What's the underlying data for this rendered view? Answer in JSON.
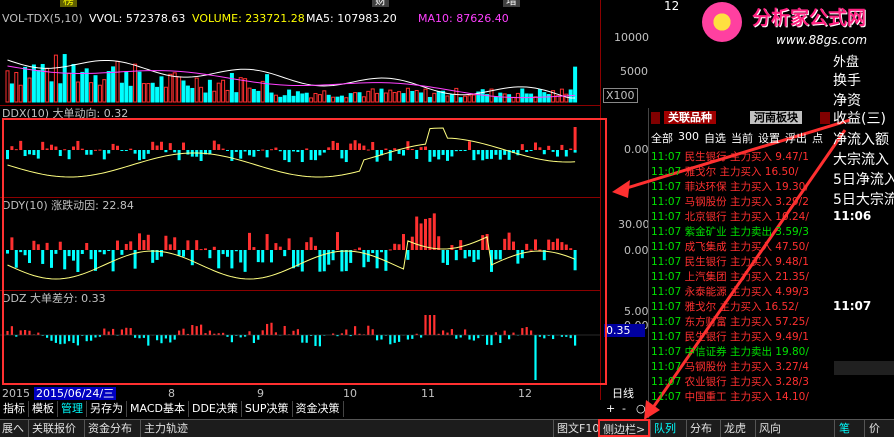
{
  "top_strip": {
    "c1": "榜",
    "c2": "财",
    "c3": "增",
    "price_top": "12"
  },
  "vol_header": {
    "name": "VOL-TDX(5,10)",
    "vvol": "VVOL: 572378.63",
    "volume": "VOLUME: 233721.28",
    "ma5": "MA5: 107983.20",
    "ma10": "MA10: 87626.40"
  },
  "vol_axis": {
    "t1": "10000",
    "t2": "5000",
    "unit": "X100"
  },
  "ddx": {
    "title": "DDX(10) 大单动向: 0.32",
    "zero": "0.00"
  },
  "ddy": {
    "title": "DDY(10) 涨跌动因: 22.84",
    "top": "30.00",
    "zero": "0.00"
  },
  "ddz": {
    "title": "DDZ 大单差分: 0.33",
    "top": "5.00",
    "zero": "0.00",
    "cur": "0.35"
  },
  "dates": {
    "year": "2015",
    "sel": "2015/06/24/三",
    "d8": "8",
    "d9": "9",
    "d10": "10",
    "d11": "11",
    "d12": "12",
    "period": "日线"
  },
  "toolbar": [
    "指标",
    "模板",
    "管理",
    "另存为",
    "MACD基本",
    "DDE决策",
    "SUP决策",
    "资金决策"
  ],
  "bottombar": {
    "b1": "展へ",
    "b2": "关联报价",
    "b3": "资金分布",
    "b4": "主力轨迹",
    "b5": "图文F10",
    "b6": "侧边栏>",
    "b7": "队列",
    "b8": "分布",
    "b9": "龙虎",
    "b10": "风向",
    "b11": "笔",
    "b12": "价"
  },
  "zoom": {
    "plus": "+",
    "minus": "-",
    "circle": "○"
  },
  "logo": {
    "main": "分析家公式网",
    "url": "www.88gs.com"
  },
  "side_tabs": {
    "t1": "关联品种",
    "t2": "河南板块"
  },
  "side_filters": [
    "全部",
    "300",
    "自选",
    "当前",
    "设置",
    "浮出",
    "点"
  ],
  "rows": [
    {
      "time": "11:07",
      "name": "民生银行",
      "dir": "主力买入",
      "val": "9.47/1",
      "g": false
    },
    {
      "time": "11:07",
      "name": "雅戈尔",
      "dir": "主力买入",
      "val": "16.50/",
      "g": false
    },
    {
      "time": "11:07",
      "name": "菲达环保",
      "dir": "主力买入",
      "val": "19.30/",
      "g": false
    },
    {
      "time": "11:07",
      "name": "马钢股份",
      "dir": "主力买入",
      "val": "3.29/2",
      "g": false
    },
    {
      "time": "11:07",
      "name": "北京银行",
      "dir": "主力买入",
      "val": "10.24/",
      "g": false
    },
    {
      "time": "11:07",
      "name": "紫金矿业",
      "dir": "主力卖出",
      "val": "3.59/3",
      "g": true
    },
    {
      "time": "11:07",
      "name": "成飞集成",
      "dir": "主力买入",
      "val": "47.50/",
      "g": false
    },
    {
      "time": "11:07",
      "name": "民生银行",
      "dir": "主力买入",
      "val": "9.48/1",
      "g": false
    },
    {
      "time": "11:07",
      "name": "上汽集团",
      "dir": "主力买入",
      "val": "21.35/",
      "g": false
    },
    {
      "time": "11:07",
      "name": "永泰能源",
      "dir": "主力买入",
      "val": "4.99/3",
      "g": false
    },
    {
      "time": "11:07",
      "name": "雅戈尔",
      "dir": "主力买入",
      "val": "16.52/",
      "g": false
    },
    {
      "time": "11:07",
      "name": "东方财富",
      "dir": "主力买入",
      "val": "57.25/",
      "g": false
    },
    {
      "time": "11:07",
      "name": "民生银行",
      "dir": "主力买入",
      "val": "9.49/1",
      "g": false
    },
    {
      "time": "11:07",
      "name": "中信证券",
      "dir": "主力卖出",
      "val": "19.80/",
      "g": true
    },
    {
      "time": "11:07",
      "name": "马钢股份",
      "dir": "主力买入",
      "val": "3.27/4",
      "g": false
    },
    {
      "time": "11:07",
      "name": "农业银行",
      "dir": "主力买入",
      "val": "3.28/3",
      "g": false
    },
    {
      "time": "11:07",
      "name": "中国重工",
      "dir": "主力买入",
      "val": "14.10/",
      "g": false
    }
  ],
  "right_panel": {
    "outer": "外盘",
    "l1": "换手",
    "l2": "净资",
    "l3": "收益(三)",
    "l4": "净流入额",
    "l5": "大宗流入",
    "l6": "5日净流入",
    "l7": "5日大宗流",
    "time1": "11:06",
    "time2": "11:07"
  },
  "colors": {
    "up": "#ff3030",
    "down": "#00ffff",
    "line": "#ffff80",
    "border": "#ff3030"
  }
}
